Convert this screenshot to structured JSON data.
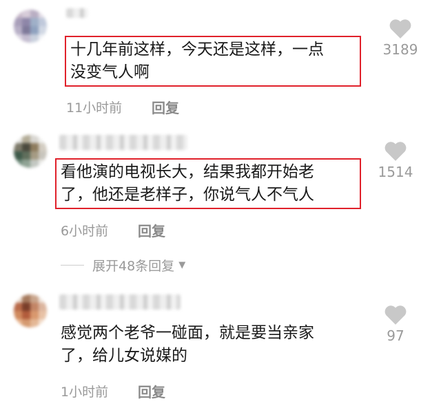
{
  "comments": [
    {
      "text_lines": [
        "十几年前这样，今天还是这样，一点",
        "没变气人啊"
      ],
      "time": "11小时前",
      "reply_label": "回复",
      "likes": "3189",
      "highlighted": true
    },
    {
      "text_lines": [
        "看他演的电视长大，结果我都开始老",
        "了，他还是老样子，你说气人不气人"
      ],
      "time": "6小时前",
      "reply_label": "回复",
      "likes": "1514",
      "highlighted": true
    },
    {
      "text_lines": [
        "感觉两个老爷一碰面，就是要当亲家",
        "了，给儿女说媒的"
      ],
      "time": "1小时前",
      "reply_label": "回复",
      "likes": "97",
      "highlighted": false
    }
  ],
  "expand_replies_label": "展开48条回复",
  "icons": {
    "like": "heart-icon",
    "expand": "triangle-down-icon"
  },
  "colors": {
    "highlight_border": "#e0202a",
    "meta_text": "#999999",
    "heart": "#c8c8c8"
  }
}
